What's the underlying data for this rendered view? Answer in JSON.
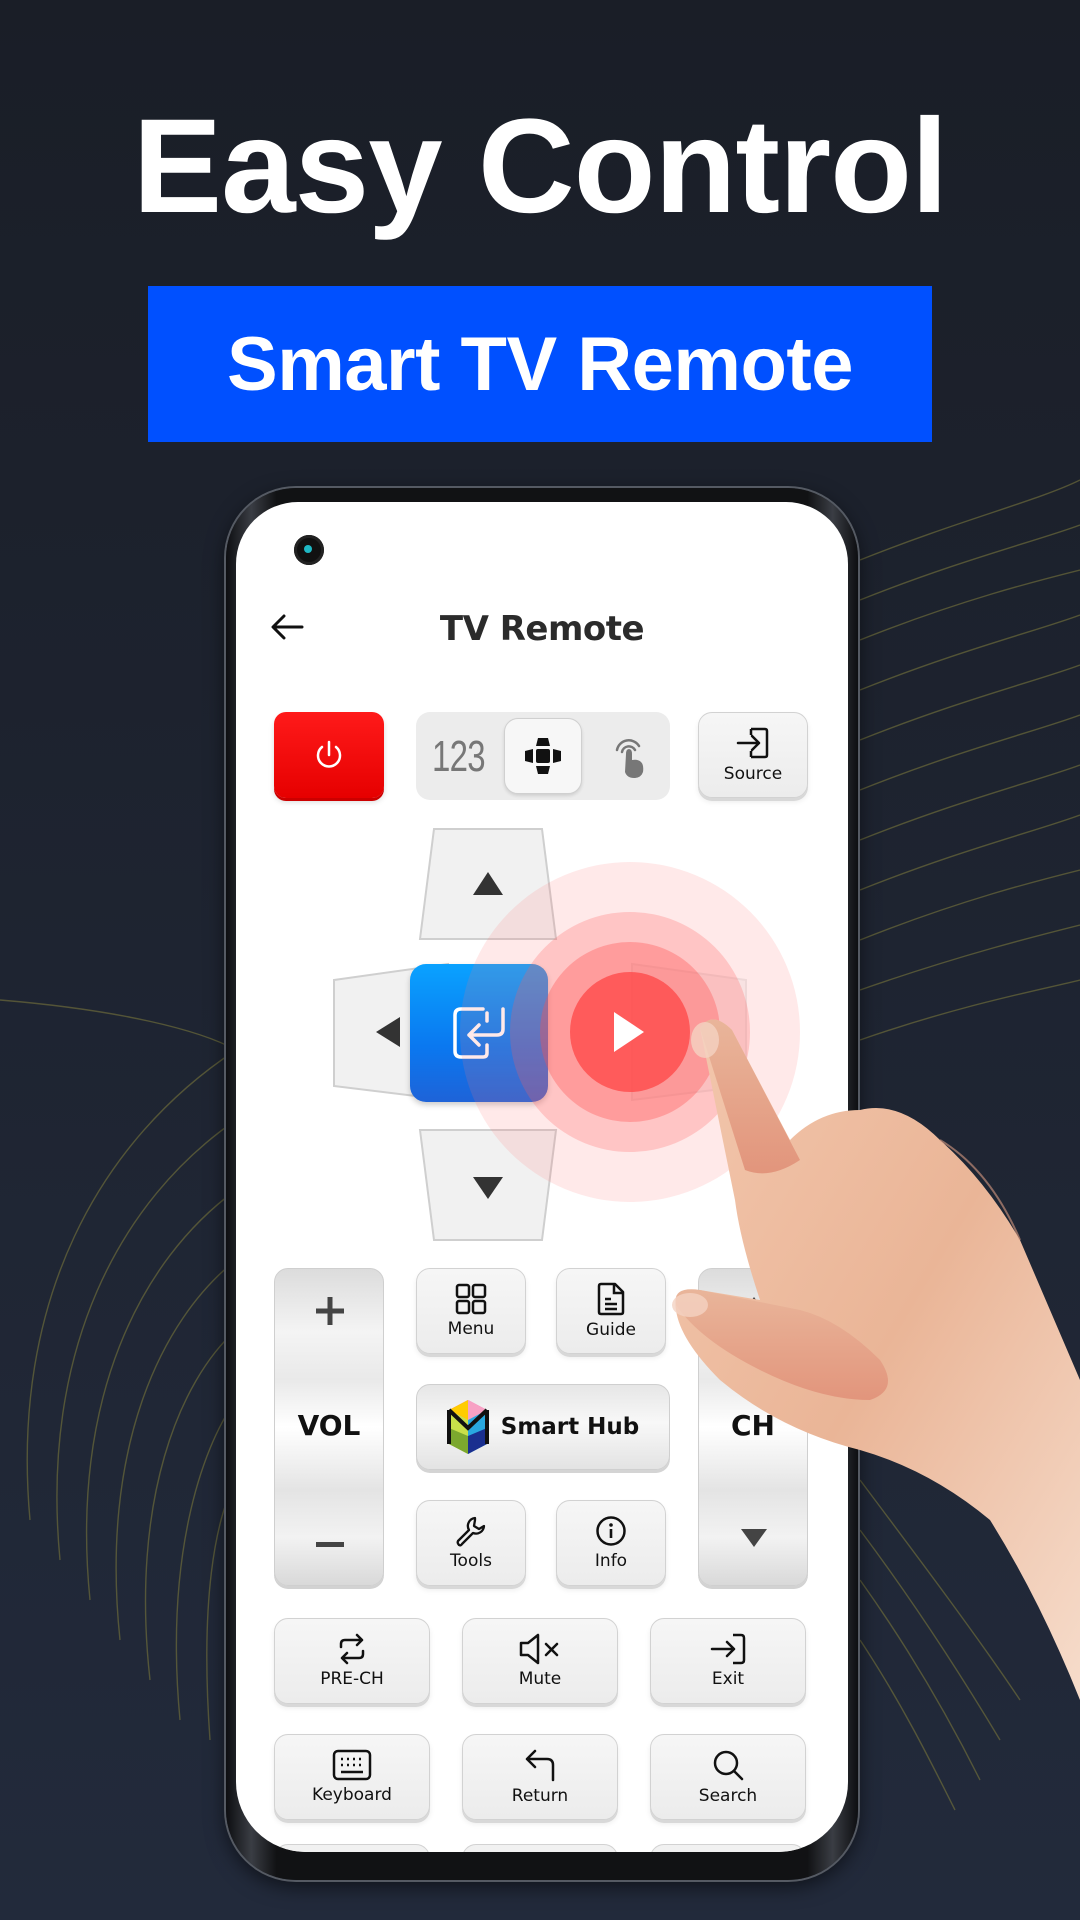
{
  "promo": {
    "headline": "Easy Control",
    "banner": "Smart TV Remote",
    "banner_color": "#0050ff",
    "background_color": "#1f2533"
  },
  "app": {
    "title": "TV Remote",
    "back_icon": "arrow-left-icon"
  },
  "top_row": {
    "power_icon": "power-icon",
    "power_color": "#ff0000",
    "modes": [
      {
        "id": "numpad",
        "label": "123",
        "selected": false
      },
      {
        "id": "dpad",
        "icon": "dpad-icon",
        "selected": true
      },
      {
        "id": "touchpad",
        "icon": "touch-icon",
        "selected": false
      }
    ],
    "source_label": "Source"
  },
  "dpad": {
    "up_icon": "triangle-up-icon",
    "down_icon": "triangle-down-icon",
    "left_icon": "triangle-left-icon",
    "right_icon": "triangle-right-icon",
    "ok_icon": "enter-icon",
    "ok_color": "#0a84ff",
    "highlight": "right"
  },
  "vol": {
    "label": "VOL",
    "plus": "+",
    "minus": "−"
  },
  "ch": {
    "label": "CH"
  },
  "grid": {
    "menu": "Menu",
    "guide": "Guide",
    "smart_hub": "Smart Hub",
    "tools": "Tools",
    "info": "Info"
  },
  "bottom": {
    "row1": [
      {
        "label": "PRE-CH",
        "icon": "swap-icon"
      },
      {
        "label": "Mute",
        "icon": "mute-icon"
      },
      {
        "label": "Exit",
        "icon": "exit-icon"
      }
    ],
    "row2": [
      {
        "label": "Keyboard",
        "icon": "keyboard-icon"
      },
      {
        "label": "Return",
        "icon": "return-icon"
      },
      {
        "label": "Search",
        "icon": "search-icon"
      }
    ]
  }
}
